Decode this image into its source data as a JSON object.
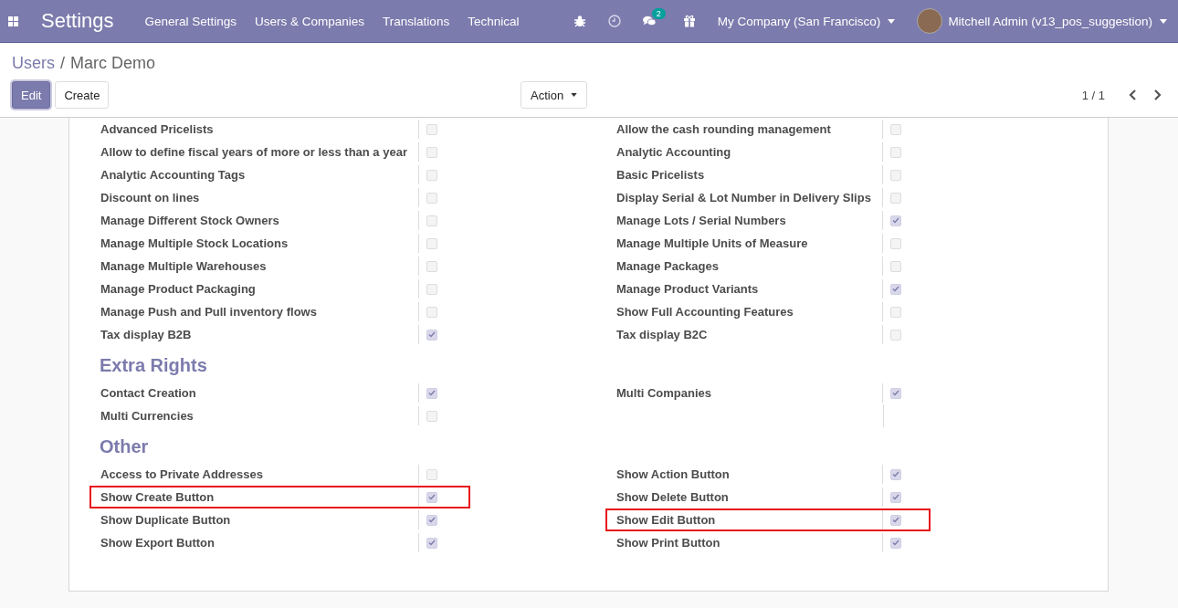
{
  "navbar": {
    "app_title": "Settings",
    "menu": [
      "General Settings",
      "Users & Companies",
      "Translations",
      "Technical"
    ],
    "messages_badge": "2",
    "company": "My Company (San Francisco)",
    "user": "Mitchell Admin (v13_pos_suggestion)"
  },
  "breadcrumb": {
    "parent": "Users",
    "separator": "/",
    "current": "Marc Demo"
  },
  "buttons": [
    {
      "label": "Edit",
      "kind": "primary"
    },
    {
      "label": "Create",
      "kind": "secondary"
    }
  ],
  "action": "Action",
  "pager": "1 / 1",
  "sections": [
    {
      "left": [
        {
          "label": "Advanced Pricelists",
          "checked": false
        },
        {
          "label": "Allow to define fiscal years of more or less than a year",
          "checked": false
        },
        {
          "label": "Analytic Accounting Tags",
          "checked": false
        },
        {
          "label": "Discount on lines",
          "checked": false
        },
        {
          "label": "Manage Different Stock Owners",
          "checked": false
        },
        {
          "label": "Manage Multiple Stock Locations",
          "checked": false
        },
        {
          "label": "Manage Multiple Warehouses",
          "checked": false
        },
        {
          "label": "Manage Product Packaging",
          "checked": false
        },
        {
          "label": "Manage Push and Pull inventory flows",
          "checked": false
        },
        {
          "label": "Tax display B2B",
          "checked": true
        }
      ],
      "right": [
        {
          "label": "Allow the cash rounding management",
          "checked": false
        },
        {
          "label": "Analytic Accounting",
          "checked": false
        },
        {
          "label": "Basic Pricelists",
          "checked": false
        },
        {
          "label": "Display Serial & Lot Number in Delivery Slips",
          "checked": false
        },
        {
          "label": "Manage Lots / Serial Numbers",
          "checked": true
        },
        {
          "label": "Manage Multiple Units of Measure",
          "checked": false
        },
        {
          "label": "Manage Packages",
          "checked": false
        },
        {
          "label": "Manage Product Variants",
          "checked": true
        },
        {
          "label": "Show Full Accounting Features",
          "checked": false
        },
        {
          "label": "Tax display B2C",
          "checked": false
        }
      ]
    },
    {
      "title": "Extra Rights",
      "left": [
        {
          "label": "Contact Creation",
          "checked": true
        },
        {
          "label": "Multi Currencies",
          "checked": false
        }
      ],
      "right": [
        {
          "label": "Multi Companies",
          "checked": true
        }
      ]
    },
    {
      "title": "Other",
      "left": [
        {
          "label": "Access to Private Addresses",
          "checked": false
        },
        {
          "label": "Show Create Button",
          "checked": true,
          "highlighted": true
        },
        {
          "label": "Show Duplicate Button",
          "checked": true
        },
        {
          "label": "Show Export Button",
          "checked": true
        }
      ],
      "right": [
        {
          "label": "Show Action Button",
          "checked": true
        },
        {
          "label": "Show Delete Button",
          "checked": true
        },
        {
          "label": "Show Edit Button",
          "checked": true,
          "highlighted": true
        },
        {
          "label": "Show Print Button",
          "checked": true
        }
      ]
    }
  ]
}
